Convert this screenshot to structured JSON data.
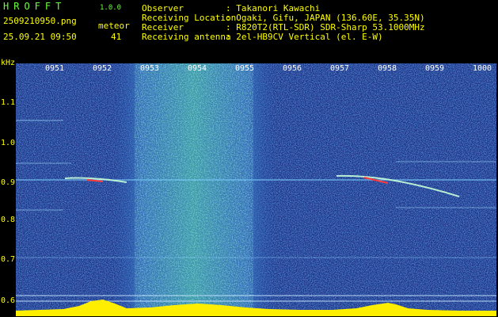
{
  "header": {
    "logo": "HROFFT",
    "version": "1.0.0",
    "filename": "2509210950.png",
    "datetime": "25.09.21 09:50",
    "meteor_label": "meteor",
    "meteor_count": "41"
  },
  "info": {
    "observer_label": "Observer",
    "observer_value": ": Takanori Kawachi",
    "location_label": "Receiving Location",
    "location_value": ": Ogaki, Gifu, JAPAN (136.60E, 35.35N)",
    "receiver_label": "Receiver",
    "receiver_value": ": R820T2(RTL-SDR) SDR-Sharp 53.1000MHz",
    "antenna_label": "Receiving antenna",
    "antenna_value": ": 2el-HB9CV Vertical (el. E-W)"
  },
  "axes": {
    "y_unit": "kHz",
    "y_ticks": [
      "1.1",
      "1.0",
      "0.9",
      "0.8",
      "0.7",
      "0.6"
    ],
    "x_ticks": [
      "0951",
      "0952",
      "0953",
      "0954",
      "0955",
      "0956",
      "0957",
      "0958",
      "0959",
      "1000"
    ]
  },
  "colors": {
    "background": "#000000",
    "header_green": "#6cff3c",
    "label_yellow": "#ffff00",
    "spectro_base": "#1a2a78"
  }
}
